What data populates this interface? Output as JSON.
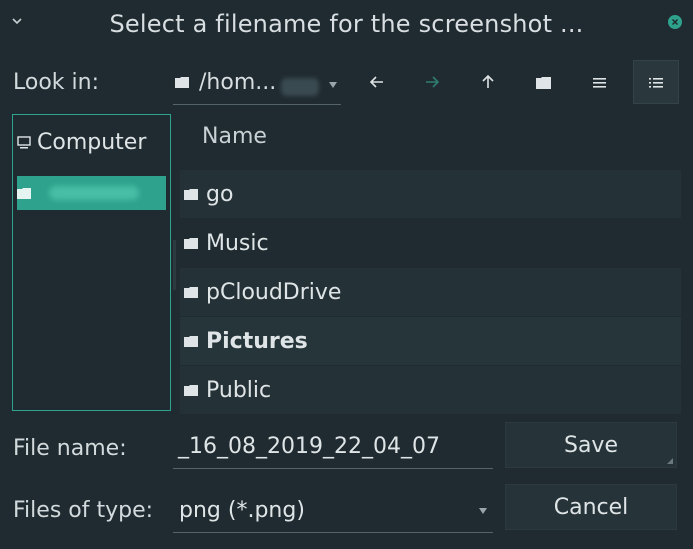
{
  "window": {
    "title": "Select a filename for the screenshot ..."
  },
  "toolbar": {
    "look_in_label": "Look in:",
    "path_text": "/hom..."
  },
  "sidebar": {
    "items": [
      {
        "label": "Computer",
        "icon": "computer-icon"
      },
      {
        "label": "",
        "icon": "folder-icon",
        "selected": true
      }
    ]
  },
  "filelist": {
    "header": "Name",
    "rows": [
      {
        "name": "go",
        "icon": "folder-icon"
      },
      {
        "name": "Music",
        "icon": "folder-icon"
      },
      {
        "name": "pCloudDrive",
        "icon": "folder-icon"
      },
      {
        "name": "Pictures",
        "icon": "folder-icon"
      },
      {
        "name": "Public",
        "icon": "folder-icon"
      }
    ]
  },
  "form": {
    "file_name_label": "File name:",
    "file_name_value": "_16_08_2019_22_04_07",
    "files_of_type_label": "Files of type:",
    "files_of_type_value": "png (*.png)"
  },
  "buttons": {
    "save": "Save",
    "cancel": "Cancel"
  },
  "colors": {
    "background": "#1f2b30",
    "accent": "#2ea28c",
    "close": "#2ea28c"
  }
}
